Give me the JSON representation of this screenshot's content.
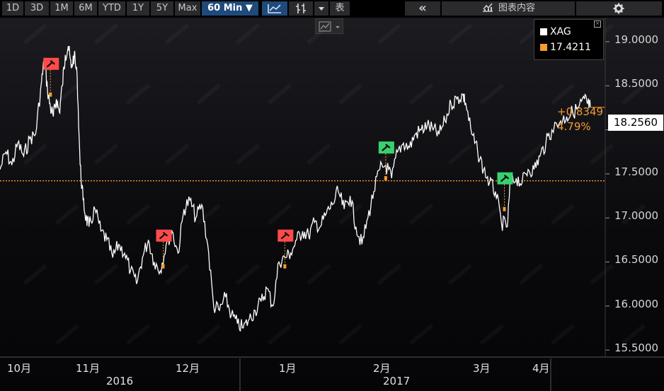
{
  "toolbar": {
    "periods": [
      {
        "label": "1D"
      },
      {
        "label": "3D"
      },
      {
        "label": "1M"
      },
      {
        "label": "6M"
      },
      {
        "label": "YTD"
      },
      {
        "label": "1Y"
      },
      {
        "label": "5Y"
      },
      {
        "label": "Max"
      }
    ],
    "interval_label": "60 Min ▼",
    "table_label": "表",
    "collapse_label": "«",
    "chart_content_label": "图表内容"
  },
  "legend": {
    "items": [
      {
        "name": "XAG",
        "color": "#ffffff"
      },
      {
        "name": "17.4211",
        "color": "#f59b30"
      }
    ]
  },
  "last_value_label": "18.2560",
  "change": {
    "abs": "+0.8349",
    "pct": "4.79%"
  },
  "colors": {
    "line": "#ffffff",
    "reference": "#f59b30",
    "flag_red": "#ff4a4a",
    "flag_green": "#37d26e",
    "marker": "#f59b30"
  },
  "chart_data": {
    "type": "line",
    "series": [
      {
        "name": "XAG",
        "color": "#ffffff"
      }
    ],
    "x_labels": [
      "10月",
      "11月",
      "12月",
      "1月",
      "2月",
      "3月",
      "4月"
    ],
    "year_labels": [
      "2016",
      "2017"
    ],
    "yticks": [
      "15.5000",
      "16.0000",
      "16.5000",
      "17.0000",
      "17.5000",
      "18.0000",
      "18.5000",
      "19.0000"
    ],
    "ylim": [
      15.35,
      19.25
    ],
    "reference_value": 17.4211,
    "last_value": 18.256,
    "x_domain": [
      "2016-09-26",
      "2017-04-18"
    ],
    "points": [
      [
        "2016-09-26",
        17.55
      ],
      [
        "2016-09-28",
        17.75
      ],
      [
        "2016-09-30",
        17.6
      ],
      [
        "2016-10-02",
        17.85
      ],
      [
        "2016-10-04",
        17.7
      ],
      [
        "2016-10-06",
        17.9
      ],
      [
        "2016-10-08",
        17.95
      ],
      [
        "2016-10-10",
        18.55
      ],
      [
        "2016-10-11",
        18.8
      ],
      [
        "2016-10-12",
        18.45
      ],
      [
        "2016-10-13",
        18.25
      ],
      [
        "2016-10-14",
        18.15
      ],
      [
        "2016-10-15",
        18.35
      ],
      [
        "2016-10-16",
        18.2
      ],
      [
        "2016-10-17",
        18.5
      ],
      [
        "2016-10-18",
        18.85
      ],
      [
        "2016-10-19",
        18.95
      ],
      [
        "2016-10-20",
        18.7
      ],
      [
        "2016-10-21",
        18.85
      ],
      [
        "2016-10-22",
        18.6
      ],
      [
        "2016-10-23",
        17.6
      ],
      [
        "2016-10-24",
        17.2
      ],
      [
        "2016-10-25",
        17.0
      ],
      [
        "2016-10-26",
        16.9
      ],
      [
        "2016-10-28",
        17.1
      ],
      [
        "2016-10-30",
        16.85
      ],
      [
        "2016-11-01",
        16.75
      ],
      [
        "2016-11-03",
        16.55
      ],
      [
        "2016-11-05",
        16.7
      ],
      [
        "2016-11-07",
        16.6
      ],
      [
        "2016-11-09",
        16.4
      ],
      [
        "2016-11-11",
        16.25
      ],
      [
        "2016-11-13",
        16.55
      ],
      [
        "2016-11-15",
        16.75
      ],
      [
        "2016-11-17",
        16.5
      ],
      [
        "2016-11-19",
        16.4
      ],
      [
        "2016-11-21",
        16.7
      ],
      [
        "2016-11-23",
        16.85
      ],
      [
        "2016-11-25",
        16.6
      ],
      [
        "2016-11-27",
        17.1
      ],
      [
        "2016-11-29",
        17.2
      ],
      [
        "2016-12-01",
        17.0
      ],
      [
        "2016-12-03",
        17.15
      ],
      [
        "2016-12-05",
        16.7
      ],
      [
        "2016-12-07",
        16.0
      ],
      [
        "2016-12-09",
        15.95
      ],
      [
        "2016-12-11",
        16.1
      ],
      [
        "2016-12-13",
        15.9
      ],
      [
        "2016-12-15",
        15.8
      ],
      [
        "2016-12-17",
        15.75
      ],
      [
        "2016-12-19",
        15.85
      ],
      [
        "2016-12-21",
        15.95
      ],
      [
        "2016-12-23",
        16.05
      ],
      [
        "2016-12-25",
        16.2
      ],
      [
        "2016-12-27",
        16.0
      ],
      [
        "2016-12-29",
        16.5
      ],
      [
        "2016-12-31",
        16.55
      ],
      [
        "2017-01-02",
        16.6
      ],
      [
        "2017-01-04",
        16.75
      ],
      [
        "2017-01-06",
        16.85
      ],
      [
        "2017-01-08",
        16.8
      ],
      [
        "2017-01-10",
        16.95
      ],
      [
        "2017-01-12",
        16.9
      ],
      [
        "2017-01-14",
        17.05
      ],
      [
        "2017-01-16",
        17.15
      ],
      [
        "2017-01-18",
        17.3
      ],
      [
        "2017-01-20",
        17.1
      ],
      [
        "2017-01-22",
        17.25
      ],
      [
        "2017-01-24",
        16.9
      ],
      [
        "2017-01-26",
        16.7
      ],
      [
        "2017-01-28",
        17.0
      ],
      [
        "2017-01-30",
        17.3
      ],
      [
        "2017-02-01",
        17.55
      ],
      [
        "2017-02-03",
        17.6
      ],
      [
        "2017-02-05",
        17.45
      ],
      [
        "2017-02-07",
        17.75
      ],
      [
        "2017-02-09",
        17.85
      ],
      [
        "2017-02-11",
        17.8
      ],
      [
        "2017-02-13",
        17.95
      ],
      [
        "2017-02-15",
        18.0
      ],
      [
        "2017-02-17",
        18.05
      ],
      [
        "2017-02-19",
        18.0
      ],
      [
        "2017-02-21",
        17.95
      ],
      [
        "2017-02-23",
        18.1
      ],
      [
        "2017-02-25",
        18.3
      ],
      [
        "2017-02-27",
        18.35
      ],
      [
        "2017-03-01",
        18.4
      ],
      [
        "2017-03-02",
        18.3
      ],
      [
        "2017-03-04",
        17.95
      ],
      [
        "2017-03-06",
        17.75
      ],
      [
        "2017-03-08",
        17.55
      ],
      [
        "2017-03-10",
        17.4
      ],
      [
        "2017-03-12",
        17.3
      ],
      [
        "2017-03-14",
        16.95
      ],
      [
        "2017-03-16",
        16.9
      ],
      [
        "2017-03-17",
        17.4
      ],
      [
        "2017-03-19",
        17.45
      ],
      [
        "2017-03-21",
        17.4
      ],
      [
        "2017-03-23",
        17.55
      ],
      [
        "2017-03-25",
        17.55
      ],
      [
        "2017-03-27",
        17.7
      ],
      [
        "2017-03-29",
        17.85
      ],
      [
        "2017-03-31",
        18.0
      ],
      [
        "2017-04-03",
        18.1
      ],
      [
        "2017-04-05",
        18.15
      ],
      [
        "2017-04-07",
        18.2
      ],
      [
        "2017-04-09",
        18.25
      ],
      [
        "2017-04-11",
        18.35
      ],
      [
        "2017-04-12",
        18.3
      ],
      [
        "2017-04-13",
        18.256
      ]
    ],
    "annotations": [
      {
        "date": "2016-10-13",
        "value": 18.4,
        "kind": "red"
      },
      {
        "date": "2016-11-20",
        "value": 16.45,
        "kind": "red"
      },
      {
        "date": "2016-12-31",
        "value": 16.45,
        "kind": "red"
      },
      {
        "date": "2017-02-03",
        "value": 17.45,
        "kind": "green"
      },
      {
        "date": "2017-03-15",
        "value": 17.1,
        "kind": "green"
      }
    ]
  }
}
